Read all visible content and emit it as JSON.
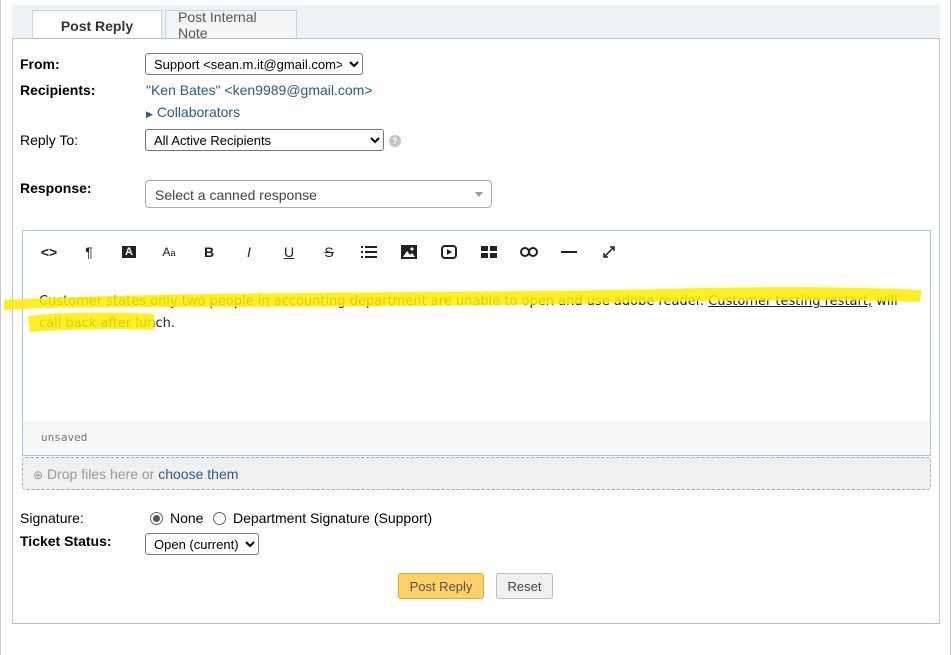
{
  "tabs": {
    "post_reply": "Post Reply",
    "post_internal_note": "Post Internal Note"
  },
  "from": {
    "label": "From:",
    "selected": "Support <sean.m.it@gmail.com>"
  },
  "recipients": {
    "label": "Recipients:",
    "value": "\"Ken Bates\" <ken9989@gmail.com>",
    "collaborators": "Collaborators"
  },
  "reply_to": {
    "label": "Reply To:",
    "selected": "All Active Recipients",
    "help_icon": "question-circle-icon"
  },
  "response": {
    "label": "Response:",
    "placeholder": "Select a canned response"
  },
  "toolbar": {
    "buttons": [
      "code-icon",
      "paragraph-icon",
      "font-color-icon",
      "font-size-icon",
      "bold-icon",
      "italic-icon",
      "underline-icon",
      "strikethrough-icon",
      "list-icon",
      "image-icon",
      "video-icon",
      "table-icon",
      "link-icon",
      "horizontal-rule-icon",
      "fullscreen-icon"
    ]
  },
  "editor": {
    "text_part1": "Customer states only two people in accounting department are unable to open and use adobe reader. ",
    "text_underlined": "Customer testing restart,",
    "text_part2": " will call back after lunch.",
    "status": "unsaved",
    "highlight_color": "#ffec00"
  },
  "dropzone": {
    "text": "Drop files here or ",
    "link": "choose them"
  },
  "signature": {
    "label": "Signature:",
    "option_none": "None",
    "option_department": "Department Signature (Support)",
    "selected": "None"
  },
  "ticket_status": {
    "label": "Ticket Status:",
    "selected": "Open (current)"
  },
  "actions": {
    "post_reply": "Post Reply",
    "reset": "Reset"
  }
}
